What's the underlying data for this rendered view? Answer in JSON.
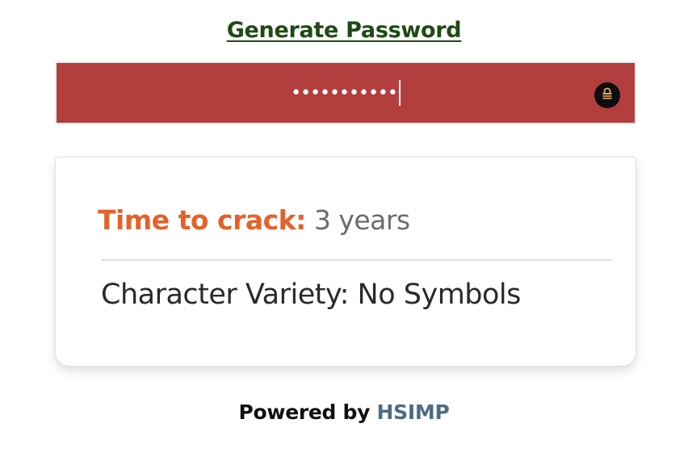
{
  "generate_link": {
    "label": "Generate Password"
  },
  "password_field": {
    "masked_value": "•••••••••••",
    "background_color": "#b33e3e",
    "toggle_icon": "lock-icon"
  },
  "result_card": {
    "time_to_crack_label": "Time to crack:",
    "time_to_crack_value": "3 years",
    "character_variety": "Character Variety: No Symbols"
  },
  "footer": {
    "powered_by_label": "Powered by",
    "brand_link": "HSIMP"
  },
  "colors": {
    "accent_orange": "#e4622a",
    "link_green": "#1f4a14",
    "brand_blue": "#4d6b86"
  }
}
